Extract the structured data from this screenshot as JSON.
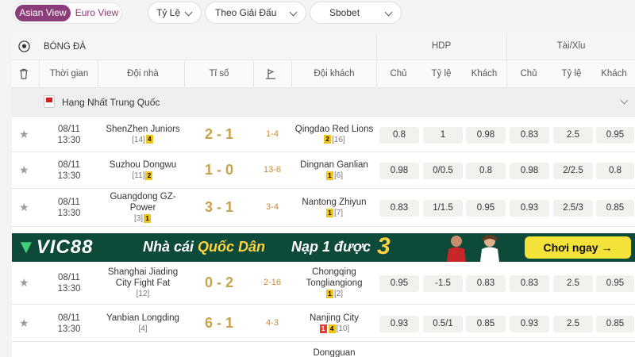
{
  "toolbar": {
    "views": [
      "Asian View",
      "Euro View"
    ],
    "dropdowns": [
      "Tỷ Lệ",
      "Theo Giải Đấu",
      "Sbobet"
    ]
  },
  "header": {
    "sport": "BÓNG ĐÁ",
    "hdp": "HDP",
    "taixiu": "Tài/Xỉu",
    "cols": [
      "Thời gian",
      "Đội nhà",
      "Tỉ số",
      "Đội khách",
      "Chủ",
      "Tỷ lệ",
      "Khách",
      "Chủ",
      "Tỷ lệ",
      "Khách"
    ]
  },
  "league": {
    "name": "Hạng Nhất Trung Quốc"
  },
  "matches": [
    {
      "date": "08/11",
      "time": "13:30",
      "home": "ShenZhen Juniors",
      "home_rank": "[14]",
      "home_cards": [
        "4"
      ],
      "score": "2 - 1",
      "corner": "1-4",
      "away": "Qingdao Red Lions",
      "away_cards": [
        "2"
      ],
      "away_rank": "[16]",
      "hdp": [
        "0.8",
        "1",
        "0.98"
      ],
      "ou": [
        "0.83",
        "2.5",
        "0.95"
      ]
    },
    {
      "date": "08/11",
      "time": "13:30",
      "home": "Suzhou Dongwu",
      "home_rank": "[11]",
      "home_cards": [
        "2"
      ],
      "score": "1 - 0",
      "corner": "13-6",
      "away": "Dingnan Ganlian",
      "away_cards": [
        "1"
      ],
      "away_rank": "[6]",
      "hdp": [
        "0.98",
        "0/0.5",
        "0.8"
      ],
      "ou": [
        "0.98",
        "2/2.5",
        "0.8"
      ]
    },
    {
      "date": "08/11",
      "time": "13:30",
      "home": "Guangdong GZ-Power",
      "home_rank": "[3]",
      "home_cards": [
        "1"
      ],
      "score": "3 - 1",
      "corner": "3-4",
      "away": "Nantong Zhiyun",
      "away_cards": [
        "1"
      ],
      "away_rank": "[7]",
      "hdp": [
        "0.83",
        "1/1.5",
        "0.95"
      ],
      "ou": [
        "0.93",
        "2.5/3",
        "0.85"
      ]
    },
    {
      "date": "08/11",
      "time": "13:30",
      "home": "Shanghai Jiading City Fight Fat",
      "home_rank": "[12]",
      "home_cards": [],
      "score": "0 - 2",
      "corner": "2-16",
      "away": "Chongqing Tongliangiong",
      "away_cards": [
        "1"
      ],
      "away_rank": "[2]",
      "hdp": [
        "0.95",
        "-1.5",
        "0.83"
      ],
      "ou": [
        "0.83",
        "2.5",
        "0.95"
      ]
    },
    {
      "date": "08/11",
      "time": "13:30",
      "home": "Yanbian Longding",
      "home_rank": "[4]",
      "home_cards": [],
      "score": "6 - 1",
      "corner": "4-3",
      "away": "Nanjing City",
      "away_cards": [
        "1r",
        "4"
      ],
      "away_rank": "[10]",
      "hdp": [
        "0.93",
        "0.5/1",
        "0.85"
      ],
      "ou": [
        "0.93",
        "2.5",
        "0.85"
      ]
    },
    {
      "date": "",
      "time": "",
      "home": "",
      "home_rank": "",
      "home_cards": [],
      "score": "",
      "corner": "",
      "away": "Dongguan",
      "away_cards": [],
      "away_rank": "",
      "hdp": [
        "",
        "",
        ""
      ],
      "ou": [
        "",
        "",
        ""
      ]
    }
  ],
  "banner": {
    "brand": "VIC88",
    "tagline_1": "Nhà cái",
    "tagline_2": "Quốc Dân",
    "promo": "Nạp 1 được",
    "promo_num": "3",
    "cta": "Chơi ngay →"
  }
}
